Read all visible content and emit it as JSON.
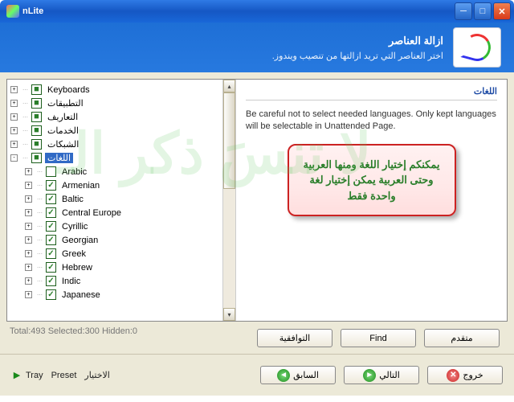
{
  "title": "nLite",
  "header": {
    "title": "ازالة العناصر",
    "subtitle": ".اختر العناصر التي تريد ازالتها من تنصيب ويندوز"
  },
  "tree": {
    "top": [
      {
        "label": "Keyboards",
        "exp": "+",
        "chk": "sq"
      },
      {
        "label": "التطبيقات",
        "exp": "+",
        "chk": "sq"
      },
      {
        "label": "التعاريف",
        "exp": "+",
        "chk": "sq"
      },
      {
        "label": "الخدمات",
        "exp": "+",
        "chk": "sq"
      },
      {
        "label": "الشبكات",
        "exp": "+",
        "chk": "sq"
      }
    ],
    "langs": {
      "label": "اللغات",
      "exp": "-",
      "chk": "sq",
      "sel": true
    },
    "children": [
      {
        "label": "Arabic",
        "exp": "+",
        "chk": "none"
      },
      {
        "label": "Armenian",
        "exp": "+",
        "chk": "ck"
      },
      {
        "label": "Baltic",
        "exp": "+",
        "chk": "ck"
      },
      {
        "label": "Central Europe",
        "exp": "+",
        "chk": "ck"
      },
      {
        "label": "Cyrillic",
        "exp": "+",
        "chk": "ck"
      },
      {
        "label": "Georgian",
        "exp": "+",
        "chk": "ck"
      },
      {
        "label": "Greek",
        "exp": "+",
        "chk": "ck"
      },
      {
        "label": "Hebrew",
        "exp": "+",
        "chk": "ck"
      },
      {
        "label": "Indic",
        "exp": "+",
        "chk": "ck"
      },
      {
        "label": "Japanese",
        "exp": "+",
        "chk": "ck"
      }
    ]
  },
  "right": {
    "title": "اللغات",
    "desc": "Be careful not to select needed languages. Only kept languages will be selectable in Unattended Page.",
    "callout": "يمكنكم إختيار اللغة ومنها العربية وحتى العربية يمكن إختيار لغة واحدة فقط"
  },
  "status": "Total:493 Selected:300 Hidden:0",
  "buttons": {
    "compat": "التوافقية",
    "find": "Find",
    "advanced": "متقدم"
  },
  "footer": {
    "tray": "Tray",
    "preset": "Preset",
    "options": "الاختيار",
    "back": "السابق",
    "next": "التالي",
    "exit": "خروج"
  }
}
